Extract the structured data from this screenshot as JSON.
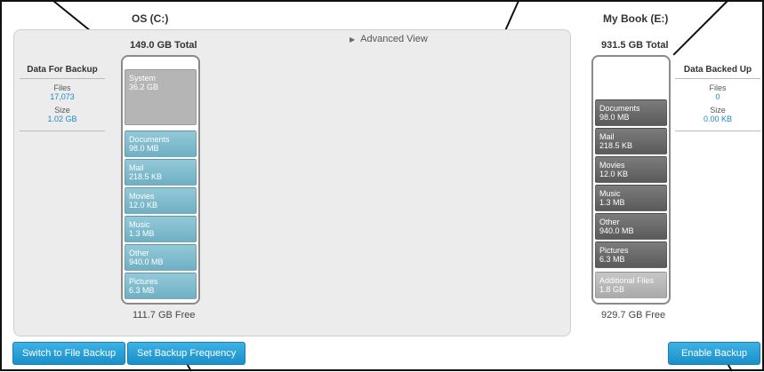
{
  "left_drive": {
    "title": "OS (C:)",
    "total": "149.0 GB Total",
    "free": "111.7 GB Free",
    "system": {
      "name": "System",
      "size": "36.2 GB"
    },
    "segments": [
      {
        "name": "Documents",
        "size": "98.0 MB"
      },
      {
        "name": "Mail",
        "size": "218.5 KB"
      },
      {
        "name": "Movies",
        "size": "12.0 KB"
      },
      {
        "name": "Music",
        "size": "1.3 MB"
      },
      {
        "name": "Other",
        "size": "940.0 MB"
      },
      {
        "name": "Pictures",
        "size": "6.3 MB"
      }
    ]
  },
  "right_drive": {
    "title": "My Book (E:)",
    "total": "931.5 GB Total",
    "free": "929.7 GB Free",
    "segments": [
      {
        "name": "Documents",
        "size": "98.0 MB"
      },
      {
        "name": "Mail",
        "size": "218.5 KB"
      },
      {
        "name": "Movies",
        "size": "12.0 KB"
      },
      {
        "name": "Music",
        "size": "1.3 MB"
      },
      {
        "name": "Other",
        "size": "940.0 MB"
      },
      {
        "name": "Pictures",
        "size": "6.3 MB"
      }
    ],
    "additional": {
      "name": "Additional Files",
      "size": "1.8 GB"
    }
  },
  "data_for_backup": {
    "heading": "Data For Backup",
    "files_label": "Files",
    "files_value": "17,073",
    "size_label": "Size",
    "size_value": "1.02 GB"
  },
  "data_backed_up": {
    "heading": "Data Backed Up",
    "files_label": "Files",
    "files_value": "0",
    "size_label": "Size",
    "size_value": "0.00 KB"
  },
  "advanced_view": "Advanced View",
  "buttons": {
    "switch": "Switch to File Backup",
    "frequency": "Set Backup Frequency",
    "enable": "Enable Backup"
  },
  "colors": {
    "accent": "#1b8ac8",
    "segment_blue": "#7fbccd",
    "segment_dark": "#6a6a6a"
  }
}
